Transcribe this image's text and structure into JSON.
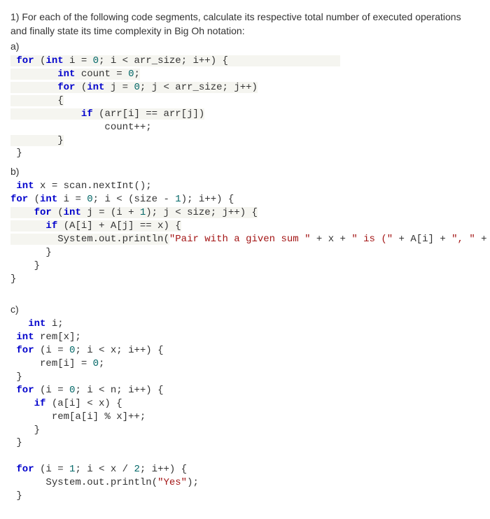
{
  "question": "1)           For each of the following code segments, calculate its respective total number of executed operations and finally state its time complexity in Big Oh notation:",
  "parts": {
    "a": {
      "label": "a)"
    },
    "b": {
      "label": "b)"
    },
    "c": {
      "label": "c)"
    }
  },
  "code_a": {
    "l1_for": "for",
    "l1_int": "int",
    "l1_rest1": " i = ",
    "l1_zero": "0",
    "l1_rest2": "; i < arr_size; i++) {",
    "l2_int": "int",
    "l2_rest1": " count = ",
    "l2_zero": "0",
    "l2_semi": ";",
    "l3_for": "for",
    "l3_int": "int",
    "l3_rest1": " j = ",
    "l3_zero": "0",
    "l3_rest2": "; j < arr_size; j++)",
    "l4_brace": "{",
    "l5_if": "if",
    "l5_rest": " (arr[i] == arr[j])",
    "l6_rest": "count++;",
    "l7_brace": "}",
    "l8_brace": "}"
  },
  "code_b": {
    "l1_int": "int",
    "l1_rest": " x = scan.nextInt();",
    "l2_for": "for",
    "l2_int": "int",
    "l2_rest1": " i = ",
    "l2_zero": "0",
    "l2_rest2": "; i < (size - ",
    "l2_one": "1",
    "l2_rest3": "); i++) {",
    "l3_for": "for",
    "l3_int": "int",
    "l3_rest1": " j = (i + ",
    "l3_one": "1",
    "l3_rest2": "); j < size; j++) {",
    "l4_if": "if",
    "l4_rest": " (A[i] + A[j] == x) {",
    "l5_rest1": "System.out.println(",
    "l5_str1": "\"Pair with a given sum \"",
    "l5_mid1": " + x + ",
    "l5_str2": "\" is (\"",
    "l5_mid2": " + A[i] + ",
    "l5_str3": "\", \"",
    "l5_mid3": " + A[j] + ",
    "l5_str4": "\")\"",
    "l5_end": ");",
    "l6_brace": "}",
    "l7_brace": "}",
    "l8_brace": "}"
  },
  "code_c": {
    "l1_int": "int",
    "l1_rest": " i;",
    "l2_int": "int",
    "l2_rest": " rem[x];",
    "l3_for": "for",
    "l3_rest1": " (i = ",
    "l3_zero": "0",
    "l3_rest2": "; i < x; i++) {",
    "l4_rest1": "rem[i] = ",
    "l4_zero": "0",
    "l4_semi": ";",
    "l5_brace": "}",
    "l6_for": "for",
    "l6_rest1": " (i = ",
    "l6_zero": "0",
    "l6_rest2": "; i < n; i++) {",
    "l7_if": "if",
    "l7_rest": " (a[i] < x) {",
    "l8_rest": "rem[a[i] % x]++;",
    "l9_brace": "}",
    "l10_brace": "}",
    "l11_for": "for",
    "l11_rest1": " (i = ",
    "l11_one": "1",
    "l11_rest2": "; i < x / ",
    "l11_two": "2",
    "l11_rest3": "; i++) {",
    "l12_rest1": "System.out.println(",
    "l12_str": "\"Yes\"",
    "l12_end": ");",
    "l13_brace": "}"
  }
}
